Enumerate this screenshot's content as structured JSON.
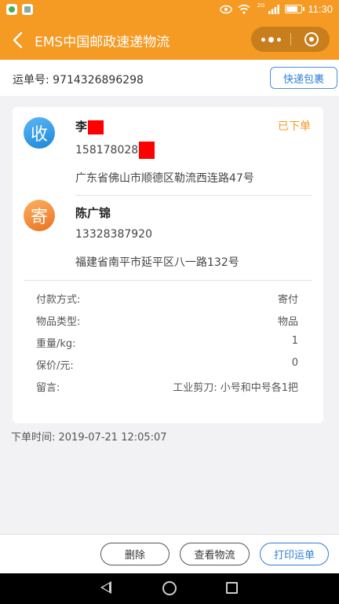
{
  "status_bar": {
    "time": "11:30",
    "signal_text": "2G"
  },
  "header": {
    "title": "EMS中国邮政速递物流"
  },
  "tracking": {
    "label": "运单号: 9714326896298",
    "quick_parcel_button": "快递包裹"
  },
  "receiver": {
    "badge": "收",
    "name": "李",
    "phone": "158178028",
    "address": "广东省佛山市顺德区勒流西连路47号"
  },
  "order_status": "已下单",
  "sender": {
    "badge": "寄",
    "name": "陈广锦",
    "phone": "13328387920",
    "address": "福建省南平市延平区八一路132号"
  },
  "details": [
    {
      "label": "付款方式:",
      "value": "寄付"
    },
    {
      "label": "物品类型:",
      "value": "物品"
    },
    {
      "label": "重量/kg:",
      "value": "1"
    },
    {
      "label": "保价/元:",
      "value": "0"
    },
    {
      "label": "留言:",
      "value": "工业剪刀: 小号和中号各1把"
    }
  ],
  "order_time": "下单时间: 2019-07-21 12:05:07",
  "actions": {
    "delete": "删除",
    "view_logistics": "查看物流",
    "print_waybill": "打印运单"
  },
  "colors": {
    "brand": "#f59a23",
    "link": "#2f7fd8",
    "redaction": "#ff0000"
  }
}
